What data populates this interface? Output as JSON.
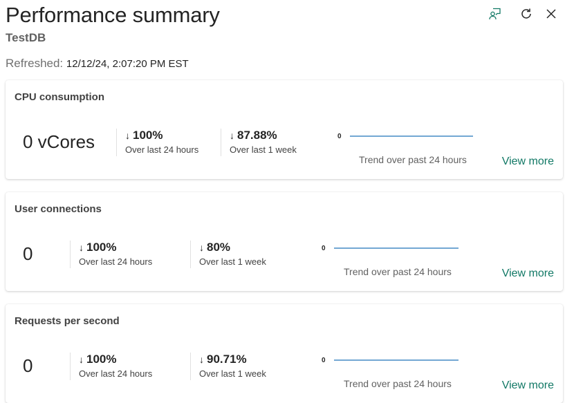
{
  "header": {
    "title": "Performance summary",
    "subtitle": "TestDB",
    "refreshed_label": "Refreshed:",
    "refreshed_time": "12/12/24, 2:07:20 PM EST",
    "icons": [
      "feedback-icon",
      "refresh-icon",
      "close-icon"
    ],
    "accent_color": "#117865"
  },
  "cards": [
    {
      "title": "CPU consumption",
      "value": "0 vCores",
      "stat1": {
        "arrow": "↓",
        "pct": "100%",
        "label": "Over last 24 hours"
      },
      "stat2": {
        "arrow": "↓",
        "pct": "87.88%",
        "label": "Over last 1 week"
      },
      "spark_axis": "0",
      "trend_label": "Trend over past 24 hours",
      "view_more": "View more"
    },
    {
      "title": "User connections",
      "value": "0",
      "stat1": {
        "arrow": "↓",
        "pct": "100%",
        "label": "Over last 24 hours"
      },
      "stat2": {
        "arrow": "↓",
        "pct": "80%",
        "label": "Over last 1 week"
      },
      "spark_axis": "0",
      "trend_label": "Trend over past 24 hours",
      "view_more": "View more"
    },
    {
      "title": "Requests per second",
      "value": "0",
      "stat1": {
        "arrow": "↓",
        "pct": "100%",
        "label": "Over last 24 hours"
      },
      "stat2": {
        "arrow": "↓",
        "pct": "90.71%",
        "label": "Over last 1 week"
      },
      "spark_axis": "0",
      "trend_label": "Trend over past 24 hours",
      "view_more": "View more"
    }
  ]
}
